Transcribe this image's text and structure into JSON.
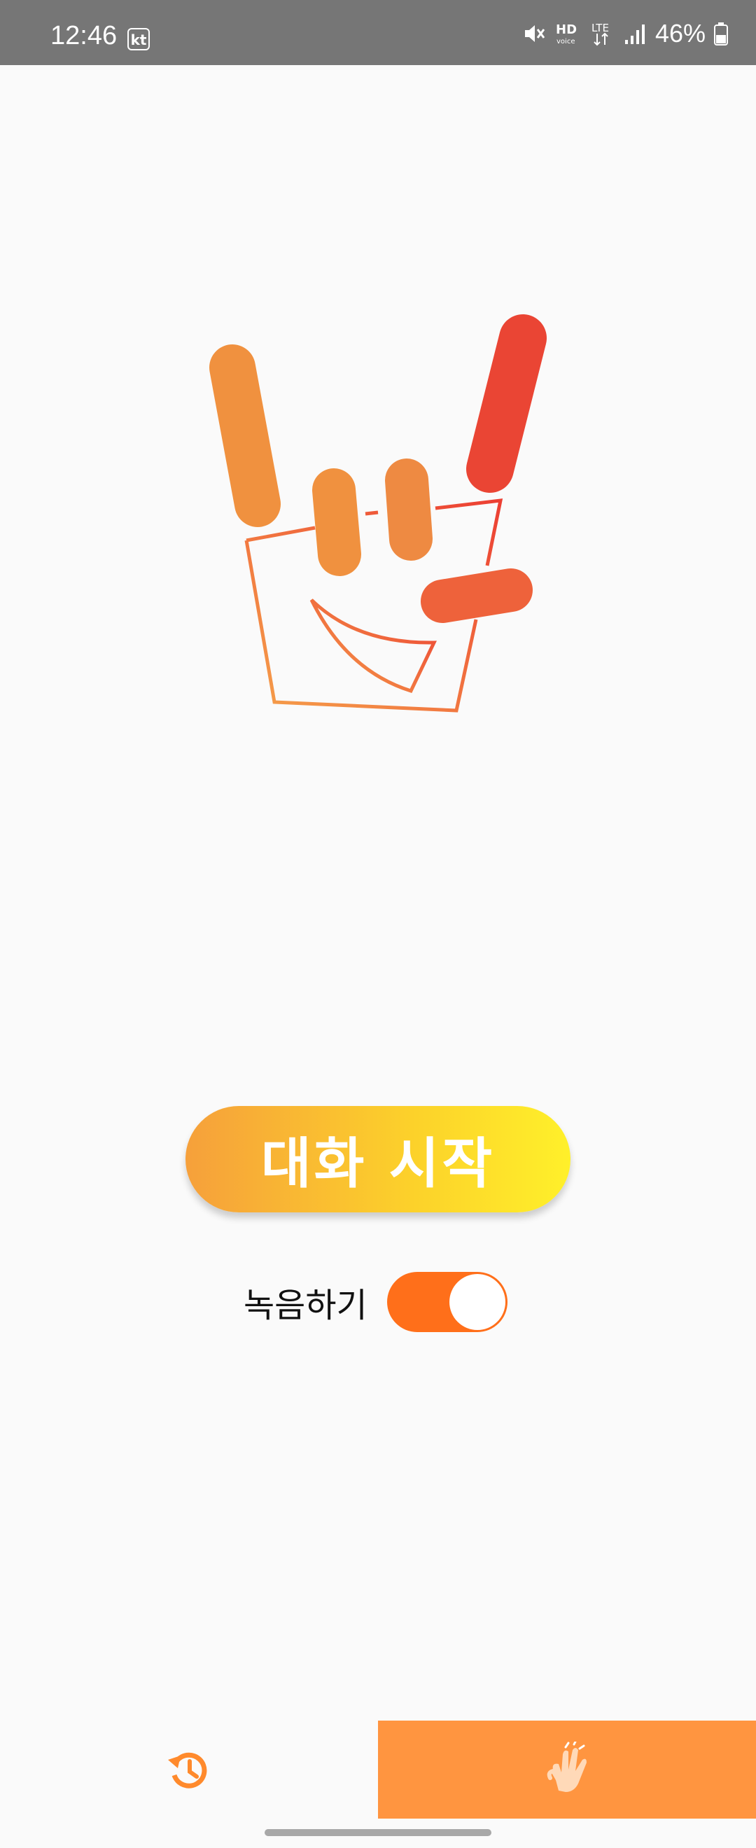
{
  "status_bar": {
    "time": "12:46",
    "carrier": "kt",
    "battery": "46%",
    "icons": [
      "mute-icon",
      "hd-voice-icon",
      "lte-icon",
      "signal-icon",
      "battery-icon"
    ]
  },
  "main": {
    "start_button_label": "대화 시작",
    "record_label": "녹음하기",
    "record_enabled": true
  },
  "bottom_nav": {
    "items": [
      {
        "icon": "history-icon",
        "active": false
      },
      {
        "icon": "sign-language-hands-icon",
        "active": true
      }
    ]
  },
  "colors": {
    "accent": "#ff9540",
    "toggle_on": "#ff6f1a",
    "button_start": "#f6a03b",
    "button_end": "#fff02a"
  }
}
